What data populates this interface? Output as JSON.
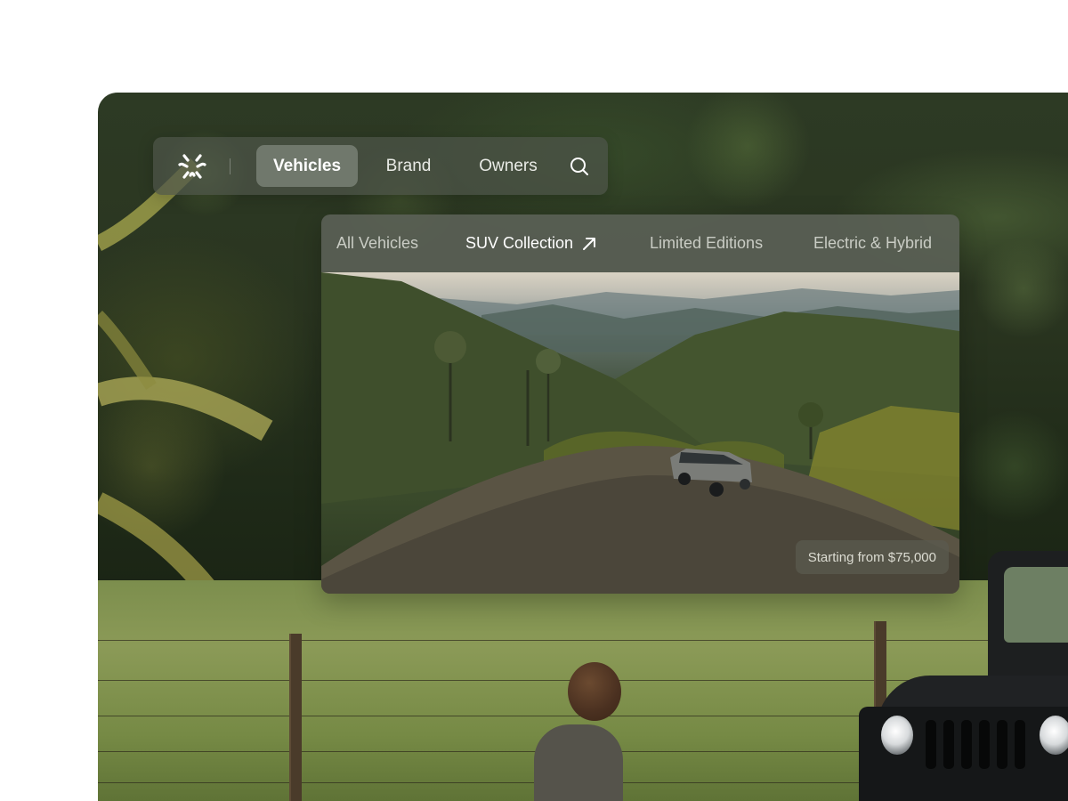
{
  "nav": {
    "logo_icon": "brand-logo-icon",
    "items": [
      {
        "label": "Vehicles",
        "active": true
      },
      {
        "label": "Brand",
        "active": false
      },
      {
        "label": "Owners",
        "active": false
      }
    ],
    "search_icon": "search-icon"
  },
  "dropdown": {
    "tabs": [
      {
        "label": "All Vehicles",
        "active": false
      },
      {
        "label": "SUV Collection",
        "active": true,
        "icon": "arrow-up-right-icon"
      },
      {
        "label": "Limited Editions",
        "active": false
      },
      {
        "label": "Electric & Hybrid",
        "active": false
      }
    ],
    "preview": {
      "price_label": "Starting from $75,000"
    }
  },
  "colors": {
    "nav_background": "#4e544a",
    "active_pill": "#969c91",
    "tab_bar": "#5c6258",
    "text_primary": "#ffffff",
    "text_muted": "#c9ccc4"
  }
}
